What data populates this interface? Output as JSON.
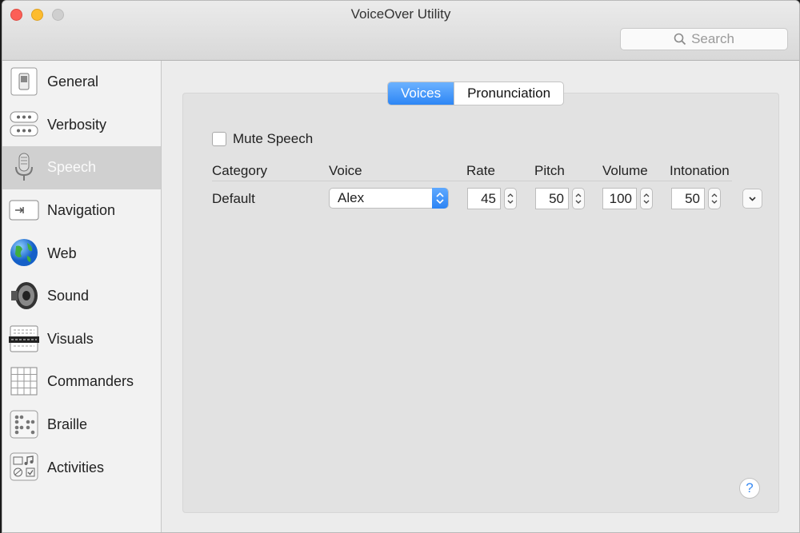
{
  "window": {
    "title": "VoiceOver Utility"
  },
  "search": {
    "placeholder": "Search"
  },
  "sidebar": {
    "items": [
      {
        "label": "General",
        "icon": "switch-icon"
      },
      {
        "label": "Verbosity",
        "icon": "speech-bubbles-icon"
      },
      {
        "label": "Speech",
        "icon": "microphone-icon",
        "selected": true
      },
      {
        "label": "Navigation",
        "icon": "tab-key-icon"
      },
      {
        "label": "Web",
        "icon": "globe-icon"
      },
      {
        "label": "Sound",
        "icon": "speaker-icon"
      },
      {
        "label": "Visuals",
        "icon": "caption-panel-icon"
      },
      {
        "label": "Commanders",
        "icon": "grid-icon"
      },
      {
        "label": "Braille",
        "icon": "braille-icon"
      },
      {
        "label": "Activities",
        "icon": "activities-icon"
      }
    ]
  },
  "tabs": {
    "voices": "Voices",
    "pronunciation": "Pronunciation",
    "selected": "Voices"
  },
  "speech": {
    "mute_label": "Mute Speech",
    "mute_checked": false,
    "headers": {
      "category": "Category",
      "voice": "Voice",
      "rate": "Rate",
      "pitch": "Pitch",
      "volume": "Volume",
      "intonation": "Intonation"
    },
    "row": {
      "category": "Default",
      "voice": "Alex",
      "rate": "45",
      "pitch": "50",
      "volume": "100",
      "intonation": "50"
    }
  },
  "help": {
    "label": "?"
  },
  "colors": {
    "accent": "#2d86f5",
    "close": "#fc5f57",
    "minimize": "#fdbc2e"
  }
}
